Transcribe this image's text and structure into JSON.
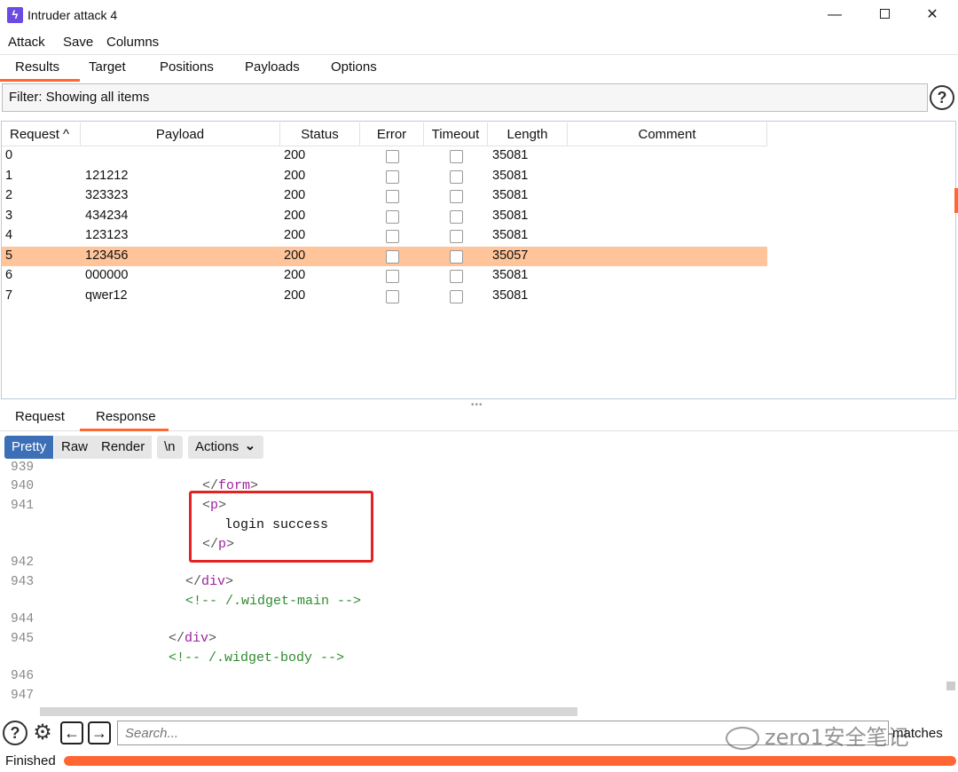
{
  "window": {
    "title": "Intruder attack 4",
    "minimize": "—",
    "close": "✕"
  },
  "menu": [
    "Attack",
    "Save",
    "Columns"
  ],
  "tabs": [
    "Results",
    "Target",
    "Positions",
    "Payloads",
    "Options"
  ],
  "filter": {
    "text": "Filter: Showing all items",
    "help": "?"
  },
  "table": {
    "columns": [
      "Request ^",
      "Payload",
      "Status",
      "Error",
      "Timeout",
      "Length",
      "Comment"
    ],
    "rows": [
      {
        "request": "0",
        "payload": "",
        "status": "200",
        "length": "35081",
        "selected": false
      },
      {
        "request": "1",
        "payload": "121212",
        "status": "200",
        "length": "35081",
        "selected": false
      },
      {
        "request": "2",
        "payload": "323323",
        "status": "200",
        "length": "35081",
        "selected": false
      },
      {
        "request": "3",
        "payload": "434234",
        "status": "200",
        "length": "35081",
        "selected": false
      },
      {
        "request": "4",
        "payload": "123123",
        "status": "200",
        "length": "35081",
        "selected": false
      },
      {
        "request": "5",
        "payload": "123456",
        "status": "200",
        "length": "35057",
        "selected": true
      },
      {
        "request": "6",
        "payload": "000000",
        "status": "200",
        "length": "35081",
        "selected": false
      },
      {
        "request": "7",
        "payload": "qwer12",
        "status": "200",
        "length": "35081",
        "selected": false
      }
    ]
  },
  "message_tabs": [
    "Request",
    "Response"
  ],
  "view_buttons": {
    "pretty": "Pretty",
    "raw": "Raw",
    "render": "Render",
    "newline": "\\n",
    "actions": "Actions"
  },
  "editor": {
    "line_numbers": [
      "939",
      "940",
      "941",
      "942",
      "943",
      "944",
      "945",
      "946",
      "947"
    ],
    "form_close": "form",
    "p_tag": "p",
    "login_text": "login success",
    "div_tag": "div",
    "comment_main": "<!-- /.widget-main -->",
    "comment_body": "<!-- /.widget-body -->"
  },
  "search": {
    "placeholder": "Search...",
    "matches": "matches",
    "help": "?",
    "prev": "←",
    "next": "→",
    "gear": "⚙"
  },
  "watermark": "zero1安全笔记",
  "status": {
    "text": "Finished",
    "progress": 1.0
  },
  "colors": {
    "accent": "#ff6633",
    "selected_row": "#ffc499",
    "tag": "#a020a0",
    "comment": "#2e8b2e",
    "highlight_box": "#e52222"
  }
}
